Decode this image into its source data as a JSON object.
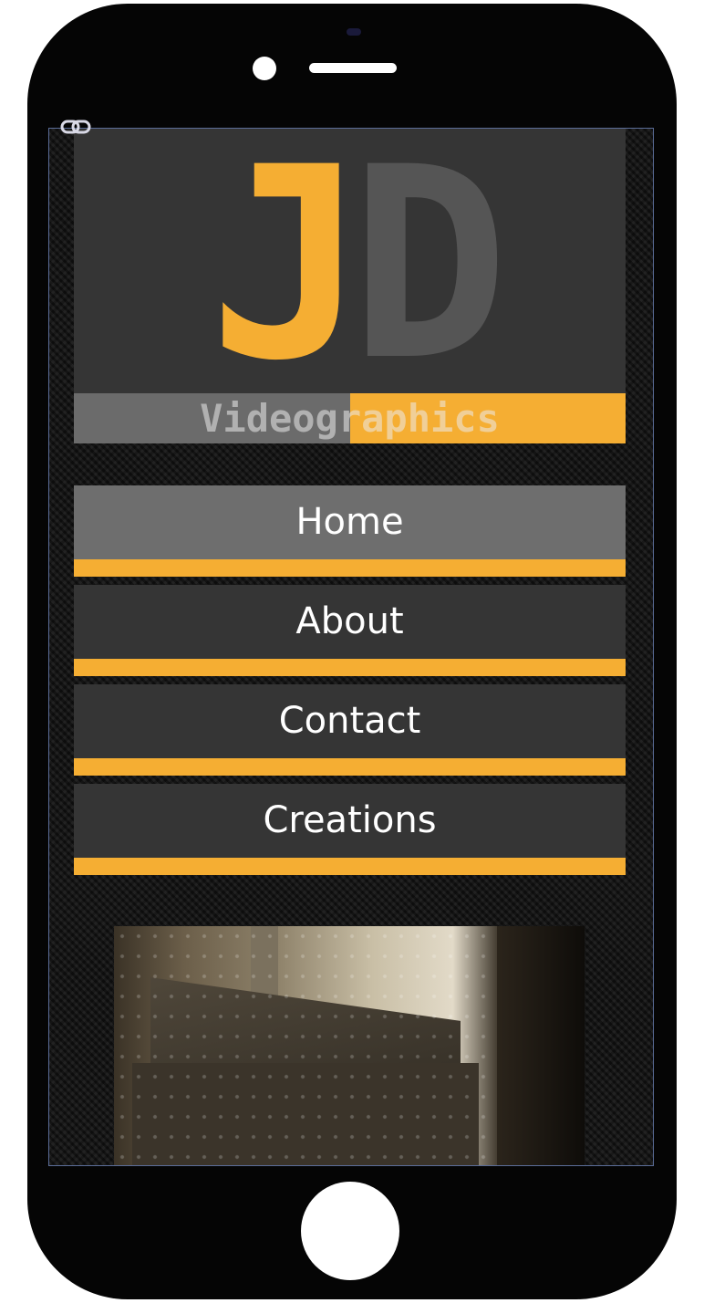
{
  "logo": {
    "letter_j": "J",
    "letter_d": "D",
    "tagline": "Videographics"
  },
  "nav": {
    "items": [
      {
        "label": "Home",
        "active": true
      },
      {
        "label": "About",
        "active": false
      },
      {
        "label": "Contact",
        "active": false
      },
      {
        "label": "Creations",
        "active": false
      }
    ]
  },
  "icons": {
    "link": "link-icon"
  },
  "colors": {
    "accent": "#f5ae33",
    "panel": "#353535",
    "active_nav": "#6e6e6e",
    "logo_d": "#555555",
    "text": "#ffffff"
  }
}
